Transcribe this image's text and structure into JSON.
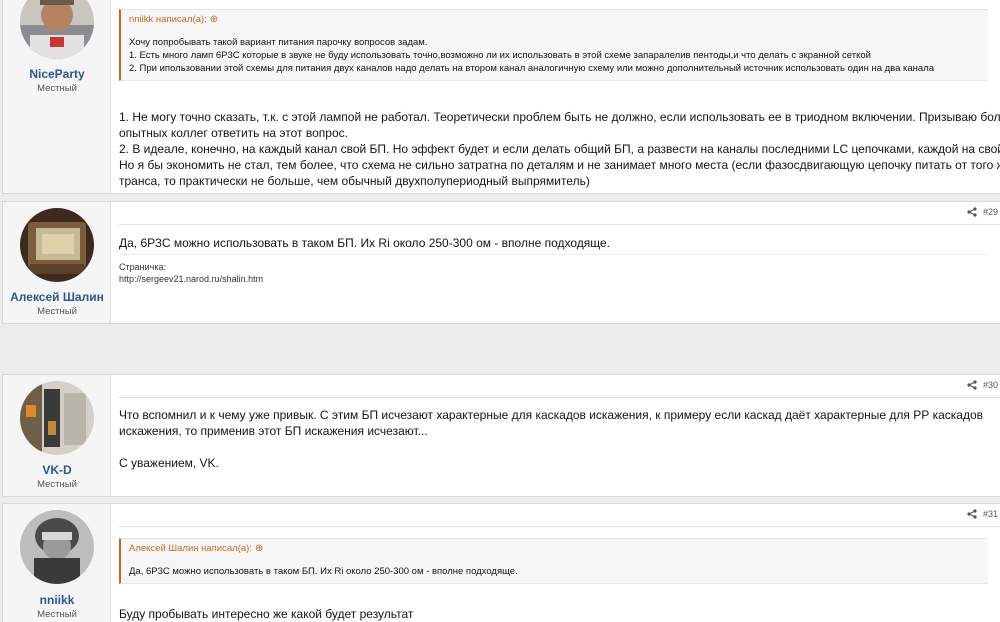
{
  "posts": [
    {
      "username": "NiceParty",
      "user_title": "Местный",
      "quote": {
        "author": "nniikk написал(а):",
        "lines": [
          "Хочу попробывать такой вариант питания парочку вопросов задам.",
          "1. Есть много ламп 6Р3С которые в звуке не буду использовать точно,возможно ли их использовать в этой схеме запаралелив пентоды,и что делать с экранной сеткой",
          "2. При ипользовании этой схемы для питания двух каналов надо делать на втором канал аналогичную схему или можно дополнительный источник использовать один на два канала"
        ]
      },
      "body_lines": [
        "1. Не могу точно сказать, т.к. с этой лампой не работал. Теоретически проблем быть не должно, если использовать ее в триодном включении. Призываю более",
        "опытных коллег ответить на этот вопрос.",
        "2. В идеале, конечно, на каждый канал свой БП. Но эффект будет и если делать общий БП, а развести на каналы последними LC цепочками, каждой на свой канал.",
        "Но я бы экономить не стал, тем более, что схема не сильно затратна по деталям и не занимает много места (если фазосдвигающую цепочку питать от того же",
        "транса, то практически не больше, чем обычный двухполупериодный выпрямитель)"
      ]
    },
    {
      "username": "Алексей Шалин",
      "user_title": "Местный",
      "post_number": "#29",
      "body_lines": [
        "Да, 6Р3С можно использовать в таком БП. Их Ri около 250-300 ом - вполне подходяще."
      ],
      "signature": {
        "label": "Страничка:",
        "url": "http://sergeev21.narod.ru/shalin.htm"
      }
    },
    {
      "username": "VK-D",
      "user_title": "Местный",
      "post_number": "#30",
      "body_lines": [
        "Что вспомнил и к чему уже привык. С этим БП исчезают характерные для каскадов искажения, к примеру если каскад даёт характерные для РР каскадов",
        "искажения, то применив этот БП искажения исчезают...",
        "",
        "С уважением, VK."
      ]
    },
    {
      "username": "nniikk",
      "user_title": "Местный",
      "post_number": "#31",
      "quote": {
        "author": "Алексей Шалин написал(а):",
        "lines": [
          "Да, 6Р3С можно использовать в таком БП. Их Ri около 250-300 ом - вполне подходяще."
        ]
      },
      "body_lines": [
        "Буду пробывать интересно же какой будет результат"
      ]
    }
  ],
  "colors": {
    "username": "#2b5694",
    "quote_accent": "#c8691e",
    "page_bg": "#ececec"
  }
}
